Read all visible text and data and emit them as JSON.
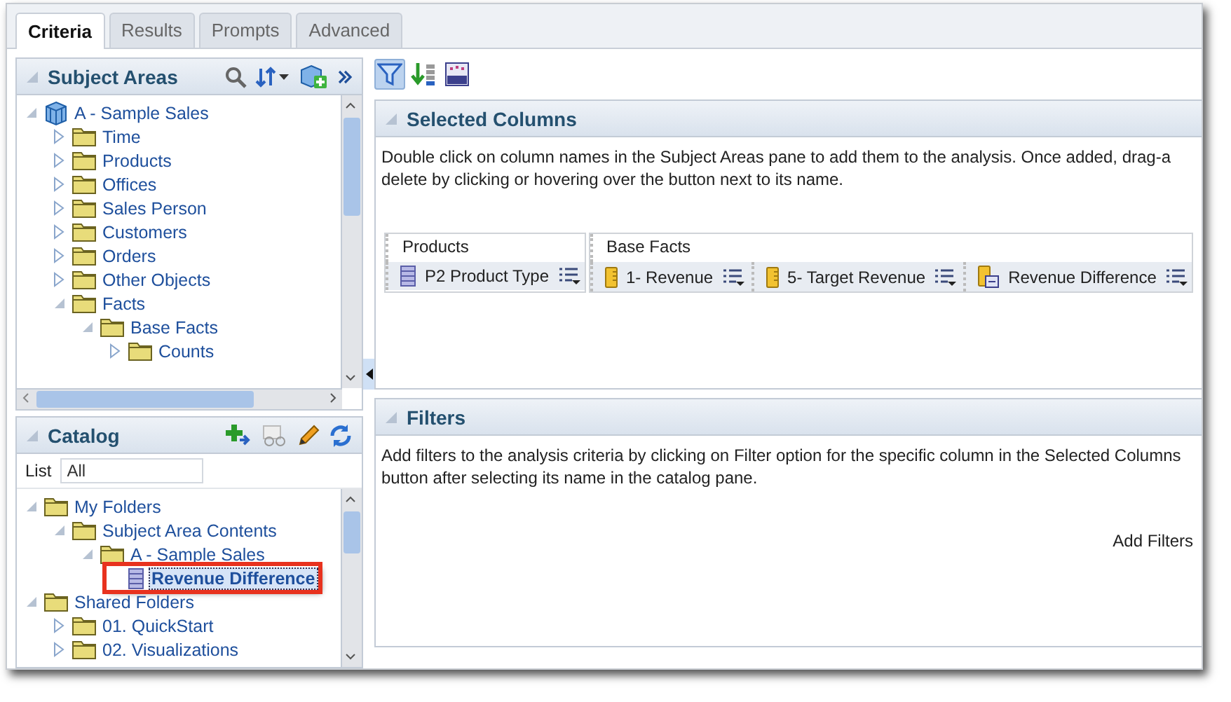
{
  "tabs": [
    {
      "label": "Criteria",
      "selected": true
    },
    {
      "label": "Results",
      "selected": false
    },
    {
      "label": "Prompts",
      "selected": false
    },
    {
      "label": "Advanced",
      "selected": false
    }
  ],
  "subject_areas": {
    "title": "Subject Areas",
    "tree": [
      {
        "label": "A - Sample Sales",
        "kind": "subject-area",
        "expanded": true,
        "selected": false,
        "children": [
          {
            "label": "Time",
            "kind": "folder",
            "expanded": false,
            "selected": false
          },
          {
            "label": "Products",
            "kind": "folder",
            "expanded": false,
            "selected": false
          },
          {
            "label": "Offices",
            "kind": "folder",
            "expanded": false,
            "selected": false
          },
          {
            "label": "Sales Person",
            "kind": "folder",
            "expanded": false,
            "selected": false
          },
          {
            "label": "Customers",
            "kind": "folder",
            "expanded": false,
            "selected": false
          },
          {
            "label": "Orders",
            "kind": "folder",
            "expanded": false,
            "selected": false
          },
          {
            "label": "Other Objects",
            "kind": "folder",
            "expanded": false,
            "selected": false
          },
          {
            "label": "Facts",
            "kind": "folder",
            "expanded": true,
            "selected": false,
            "children": [
              {
                "label": "Base Facts",
                "kind": "folder",
                "expanded": true,
                "selected": false,
                "children": [
                  {
                    "label": "Counts",
                    "kind": "folder",
                    "expanded": false,
                    "selected": false
                  }
                ]
              }
            ]
          }
        ]
      }
    ]
  },
  "catalog": {
    "title": "Catalog",
    "list_label": "List",
    "list_value": "All",
    "tree": [
      {
        "label": "My Folders",
        "kind": "folder",
        "expanded": true,
        "selected": false,
        "children": [
          {
            "label": "Subject Area Contents",
            "kind": "folder",
            "expanded": true,
            "selected": false,
            "children": [
              {
                "label": "A - Sample Sales",
                "kind": "folder",
                "expanded": true,
                "selected": false,
                "children": [
                  {
                    "label": "Revenue Difference",
                    "kind": "column",
                    "selected": true,
                    "callout": true
                  }
                ]
              }
            ]
          }
        ]
      },
      {
        "label": "Shared Folders",
        "kind": "folder",
        "expanded": true,
        "selected": false,
        "children": [
          {
            "label": "01. QuickStart",
            "kind": "folder",
            "expanded": false,
            "selected": false
          },
          {
            "label": "02. Visualizations",
            "kind": "folder",
            "expanded": false,
            "selected": false
          }
        ]
      }
    ]
  },
  "selected_columns": {
    "title": "Selected Columns",
    "description": "Double click on column names in the Subject Areas pane to add them to the analysis. Once added, drag-a",
    "description_line2": "delete by clicking or hovering over the button next to its name.",
    "groups": [
      {
        "name": "Products",
        "columns": [
          {
            "label": "P2 Product Type",
            "kind": "attribute"
          }
        ]
      },
      {
        "name": "Base Facts",
        "columns": [
          {
            "label": "1- Revenue",
            "kind": "measure"
          },
          {
            "label": "5- Target Revenue",
            "kind": "measure"
          },
          {
            "label": "Revenue Difference",
            "kind": "calculated"
          }
        ]
      }
    ]
  },
  "filters": {
    "title": "Filters",
    "description": "Add filters to the analysis criteria by clicking on Filter option for the specific column in the Selected Columns",
    "description_line2": "button after selecting its name in the catalog pane.",
    "add_filters_label": "Add Filters"
  }
}
